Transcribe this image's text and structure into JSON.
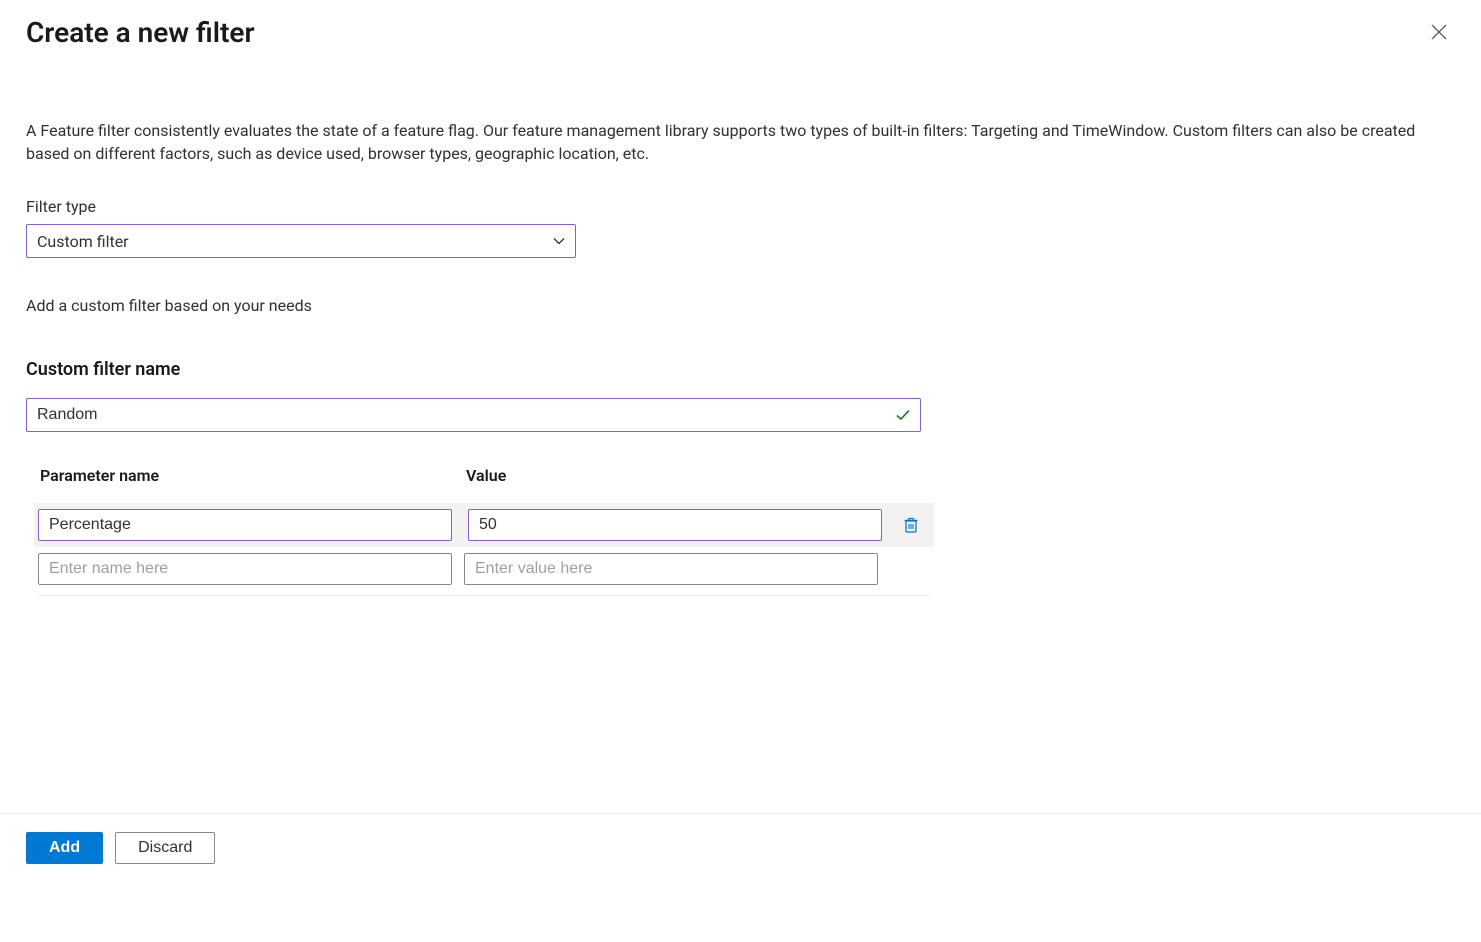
{
  "header": {
    "title": "Create a new filter"
  },
  "description": "A Feature filter consistently evaluates the state of a feature flag. Our feature management library supports two types of built-in filters: Targeting and TimeWindow. Custom filters can also be created based on different factors, such as device used, browser types, geographic location, etc.",
  "filterType": {
    "label": "Filter type",
    "selected": "Custom filter"
  },
  "helperText": "Add a custom filter based on your needs",
  "customFilter": {
    "heading": "Custom filter name",
    "value": "Random"
  },
  "params": {
    "columns": {
      "name": "Parameter name",
      "value": "Value"
    },
    "rows": [
      {
        "name": "Percentage",
        "value": "50"
      }
    ],
    "placeholders": {
      "name": "Enter name here",
      "value": "Enter value here"
    }
  },
  "footer": {
    "add": "Add",
    "discard": "Discard"
  }
}
